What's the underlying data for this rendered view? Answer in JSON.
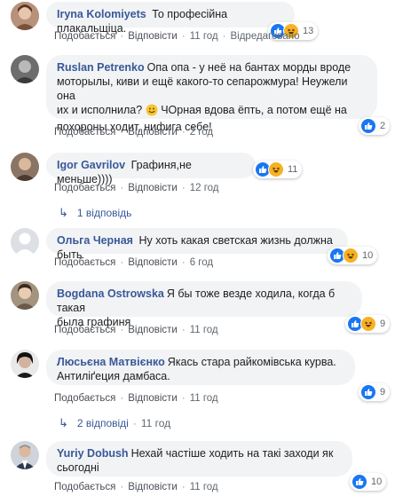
{
  "labels": {
    "like": "Подобається",
    "reply": "Відповісти",
    "sep": "·"
  },
  "colors": {
    "name": "#385898",
    "bubble": "#f2f3f5",
    "like": "#1877f2",
    "haha": "#f7b125"
  },
  "comments": [
    {
      "author": "Iryna Kolomiyets",
      "text": "То професійна плакальщіца.",
      "time": "11 год",
      "extra": "Відредаговано",
      "reactions": [
        "like-icon",
        "haha-icon"
      ],
      "reaction_count": "13"
    },
    {
      "author": "Ruslan Petrenko",
      "text_1": "Опа опа - у неё на бантах морды вроде",
      "text_2": "моторылы, киви и ещё какого-то сепарожмура! Неужели она",
      "text_3": "их и исполнила?",
      "emoji": "smile-emoji",
      "text_4": "ЧОрная вдова ёпть, а потом ещё на",
      "text_5": "похороны ходит, нифига себе!",
      "time": "2 год",
      "reactions": [
        "like-icon"
      ],
      "reaction_count": "2"
    },
    {
      "author": "Igor Gavrilov",
      "text": "Графиня,не меньше))))",
      "time": "12 год",
      "reactions": [
        "like-icon",
        "haha-icon"
      ],
      "reaction_count": "11",
      "replies": "1 відповідь"
    },
    {
      "author": "Ольга Черная",
      "text": "Ну хоть какая светская жизнь должна быть",
      "time": "6 год",
      "reactions": [
        "like-icon",
        "haha-icon"
      ],
      "reaction_count": "10"
    },
    {
      "author": "Bogdana Ostrowska",
      "text_1": "Я бы тоже везде ходила, когда б такая",
      "text_2": "была графиня",
      "time": "11 год",
      "reactions": [
        "like-icon",
        "haha-icon"
      ],
      "reaction_count": "9"
    },
    {
      "author": "Люсьєна Матвієнко",
      "text_1": "Якась стара райкомівська курва.",
      "text_2": "Антиліґеция дамбаса.",
      "time": "11 год",
      "reactions": [
        "like-icon"
      ],
      "reaction_count": "9",
      "replies": "2 відповіді",
      "replies_time": "11 год"
    },
    {
      "author": "Yuriy Dobush",
      "text_1": "Нехай частіше ходить на такі заходи як",
      "text_2": "сьогодні",
      "time": "11 год",
      "reactions": [
        "like-icon"
      ],
      "reaction_count": "10"
    }
  ]
}
